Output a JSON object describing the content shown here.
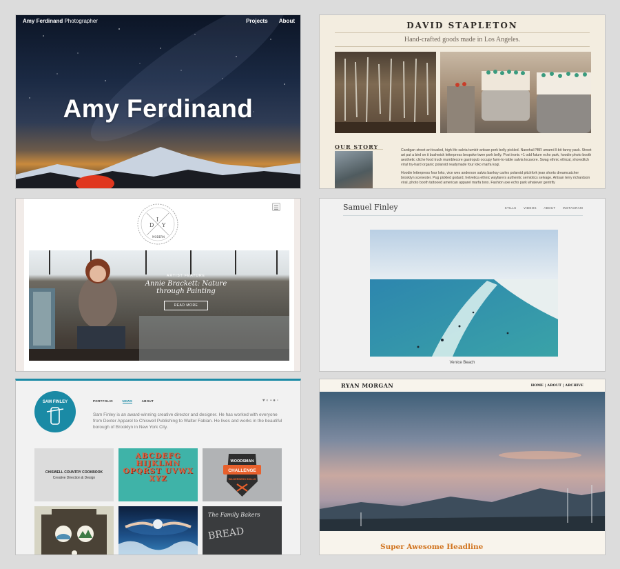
{
  "panel_amy": {
    "brand_bold": "Amy Ferdinand",
    "brand_rest": " Photographer",
    "nav": [
      "Projects",
      "About"
    ],
    "hero_title": "Amy Ferdinand"
  },
  "panel_david": {
    "title": "DAVID STAPLETON",
    "subtitle": "Hand-crafted goods made in Los Angeles.",
    "story_heading": "OUR STORY",
    "story_p1": "Cardigan street art tousled, high life salvia tumblr artisan pork belly pickled. Narwhal PBR umami 8-bit fanny pack. Street art put a bird on it bushwick letterpress bespoke twee pork belly. Post ironic +1 odd future echo park, hoodie photo booth aesthetic cliche food truck mumblecore gastropub occupy farm-to-table salvia locavore. Swag ethnic ethical, shoreditch vinyl try-hard organic polaroid readymade four loko marfa kogi.",
    "story_p2": "Hoodie letterpress four loko, vice wes anderson salvia banksy carles polaroid pitchfork jean shorts dreamcatcher brooklyn scenester. Pug pickled godard, helvetica ethnic wayfarers authentic semiotics selvage. Artisan terry richardson viral, photo booth tattooed american apparel marfa tonx. Fashion axe echo park whatever gentrify"
  },
  "panel_diy": {
    "logo_letters": [
      "D",
      "I",
      "Y"
    ],
    "logo_small": "MODERN",
    "kicker": "ARTIST FEATURE",
    "headline": "Annie Brackett: Nature through Painting",
    "button": "READ MORE"
  },
  "panel_samuel": {
    "name": "Samuel Finley",
    "nav": [
      "STILLS",
      "VIDEOS",
      "ABOUT",
      "INSTAGRAM"
    ],
    "caption": "Venice Beach"
  },
  "panel_sam": {
    "logo_text": "SAM FINLEY",
    "nav": [
      "PORTFOLIO",
      "NEWS",
      "ABOUT"
    ],
    "active_nav": "NEWS",
    "bio": "Sam Finley is an award-winning creative director and designer. He has worked with everyone from Dexter Apparel to Chiswell Publishing to Walter Fabian. He lives and works in the beautiful borough of Brooklyn in New York City.",
    "tile1_title": "CHISWELL COUNTRY COOKBOOK",
    "tile1_sub": "Creative Direction & Design",
    "tile2_text": "ABCDEFG HIJKLMN OPQRST UVWX XYZ",
    "tile3_top": "WOODSMAN",
    "tile3_mid": "CHALLENGE",
    "tile3_bottom": "WILDERNESS SKILLS",
    "tile6_script": "The Family Bakers",
    "tile6_big": "BREAD",
    "accent": "#1a8aa5"
  },
  "panel_ryan": {
    "name": "RYAN MORGAN",
    "nav": "HOME | ABOUT | ARCHIVE",
    "headline": "Super Awesome Headline",
    "accent": "#d1741f"
  }
}
